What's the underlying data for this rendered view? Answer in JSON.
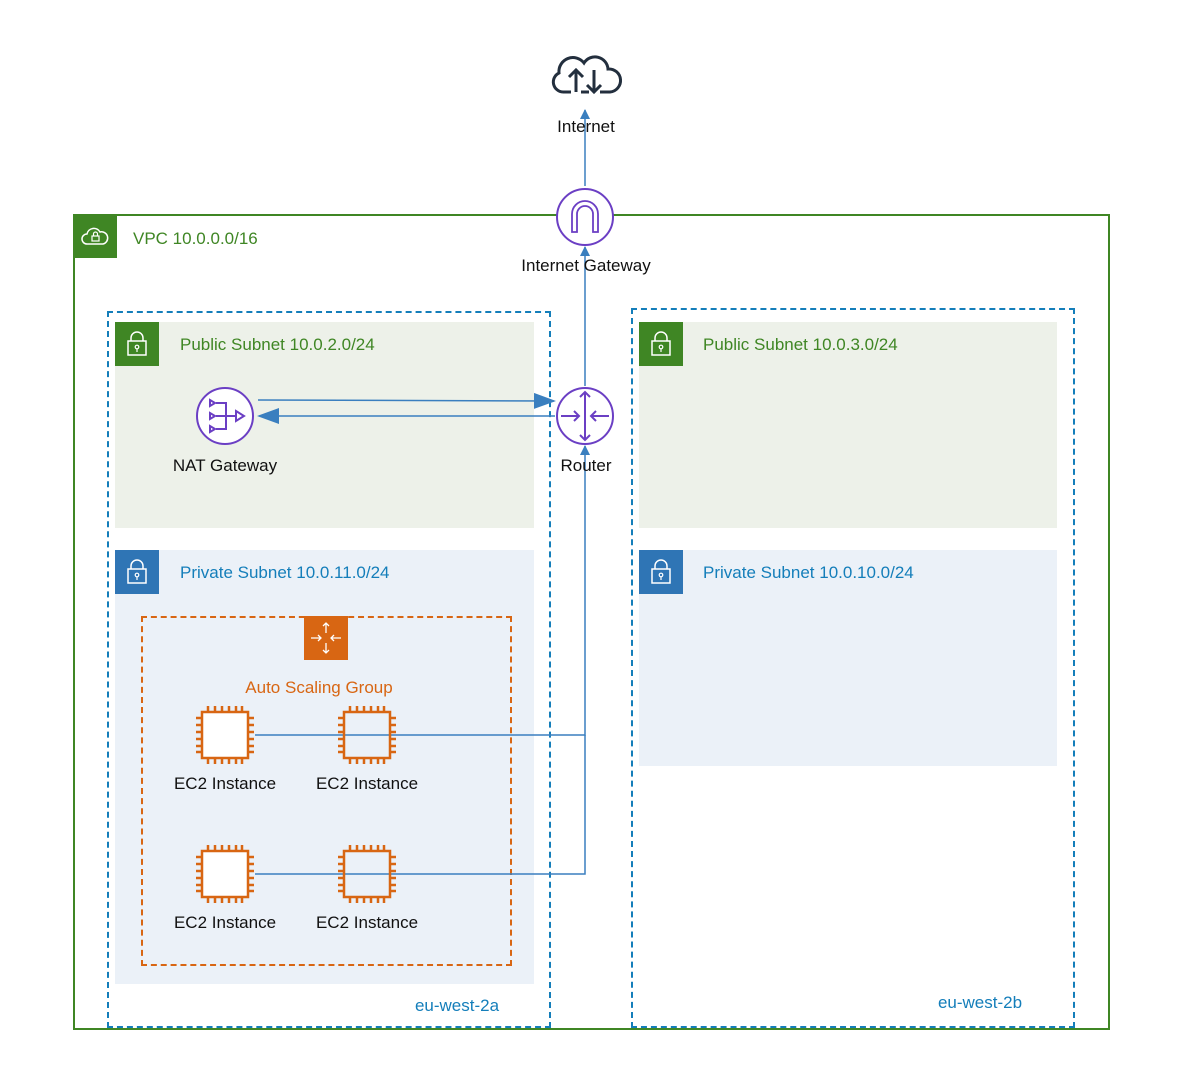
{
  "colors": {
    "vpc": "#3f8624",
    "az": "#147eba",
    "public_fill": "#edf1e9",
    "private_fill": "#ebf1f8",
    "asg": "#d86613",
    "service": "#6b3fc4",
    "connector": "#3a7fbf",
    "internet": "#232f3e"
  },
  "internet": {
    "label": "Internet",
    "icon": "cloud-upload-download-icon"
  },
  "internet_gateway": {
    "label": "Internet Gateway",
    "icon": "internet-gateway-icon"
  },
  "vpc": {
    "label": "VPC 10.0.0.0/16",
    "icon": "vpc-cloud-lock-icon"
  },
  "availability_zones": [
    {
      "label": "eu-west-2a"
    },
    {
      "label": "eu-west-2b"
    }
  ],
  "subnets": {
    "public_a": {
      "label": "Public Subnet 10.0.2.0/24",
      "icon": "lock-icon"
    },
    "private_a": {
      "label": "Private Subnet 10.0.11.0/24",
      "icon": "lock-icon"
    },
    "public_b": {
      "label": "Public Subnet 10.0.3.0/24",
      "icon": "lock-icon"
    },
    "private_b": {
      "label": "Private Subnet 10.0.10.0/24",
      "icon": "lock-icon"
    }
  },
  "nat_gateway": {
    "label": "NAT Gateway",
    "icon": "nat-gateway-icon"
  },
  "router": {
    "label": "Router",
    "icon": "router-icon"
  },
  "auto_scaling_group": {
    "label": "Auto Scaling Group",
    "icon": "auto-scaling-icon"
  },
  "ec2_instances": [
    {
      "label": "EC2 Instance"
    },
    {
      "label": "EC2 Instance"
    },
    {
      "label": "EC2 Instance"
    },
    {
      "label": "EC2 Instance"
    }
  ]
}
